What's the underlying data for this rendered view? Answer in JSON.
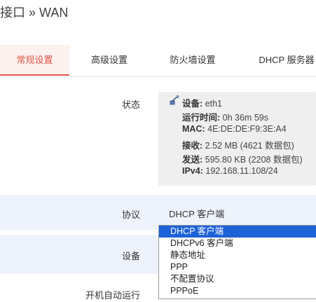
{
  "page_title": "接口 » WAN",
  "tabs": [
    {
      "label": "常规设置",
      "active": true
    },
    {
      "label": "高级设置",
      "active": false
    },
    {
      "label": "防火墙设置",
      "active": false
    },
    {
      "label": "DHCP 服务器",
      "active": false
    }
  ],
  "status": {
    "label": "状态",
    "icon": "network-port-icon",
    "device_key": "设备:",
    "device_val": "eth1",
    "uptime_key": "运行时间:",
    "uptime_val": "0h 36m 59s",
    "mac_key": "MAC:",
    "mac_val": "4E:DE:DE:F9:3E:A4",
    "rx_key": "接收:",
    "rx_val": "2.52 MB (4621 数据包)",
    "tx_key": "发送:",
    "tx_val": "595.80 KB (2208 数据包)",
    "ipv4_key": "IPv4:",
    "ipv4_val": "192.168.11.108/24"
  },
  "protocol": {
    "label": "协议",
    "value": "DHCP 客户端",
    "options": [
      "DHCP 客户端",
      "DHCPv6 客户端",
      "静态地址",
      "PPP",
      "不配置协议",
      "PPPoE"
    ],
    "selected_index": 0
  },
  "device_row": {
    "label": "设备"
  },
  "autostart_row": {
    "label": "开机自动运行"
  },
  "colors": {
    "accent": "#e0584a",
    "select": "#1e62d8",
    "band": "#eef3fb"
  }
}
